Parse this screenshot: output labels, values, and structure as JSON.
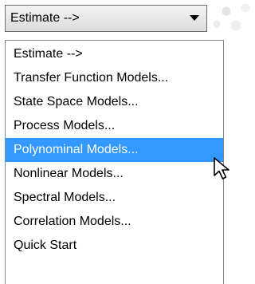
{
  "combo": {
    "selected": "Estimate -->",
    "arrow_icon": "dropdown-triangle-icon"
  },
  "menu": {
    "items": [
      {
        "label": "Estimate -->"
      },
      {
        "label": "Transfer Function Models..."
      },
      {
        "label": "State Space Models..."
      },
      {
        "label": "Process Models..."
      },
      {
        "label": "Polynominal Models...",
        "highlighted": true
      },
      {
        "label": "Nonlinear Models..."
      },
      {
        "label": "Spectral Models..."
      },
      {
        "label": "Correlation Models..."
      },
      {
        "label": "Quick Start"
      }
    ]
  },
  "colors": {
    "highlight": "#3399ff",
    "highlight_text": "#ffffff",
    "menu_border": "#828790"
  },
  "cursor_icon": "mouse-pointer-icon"
}
